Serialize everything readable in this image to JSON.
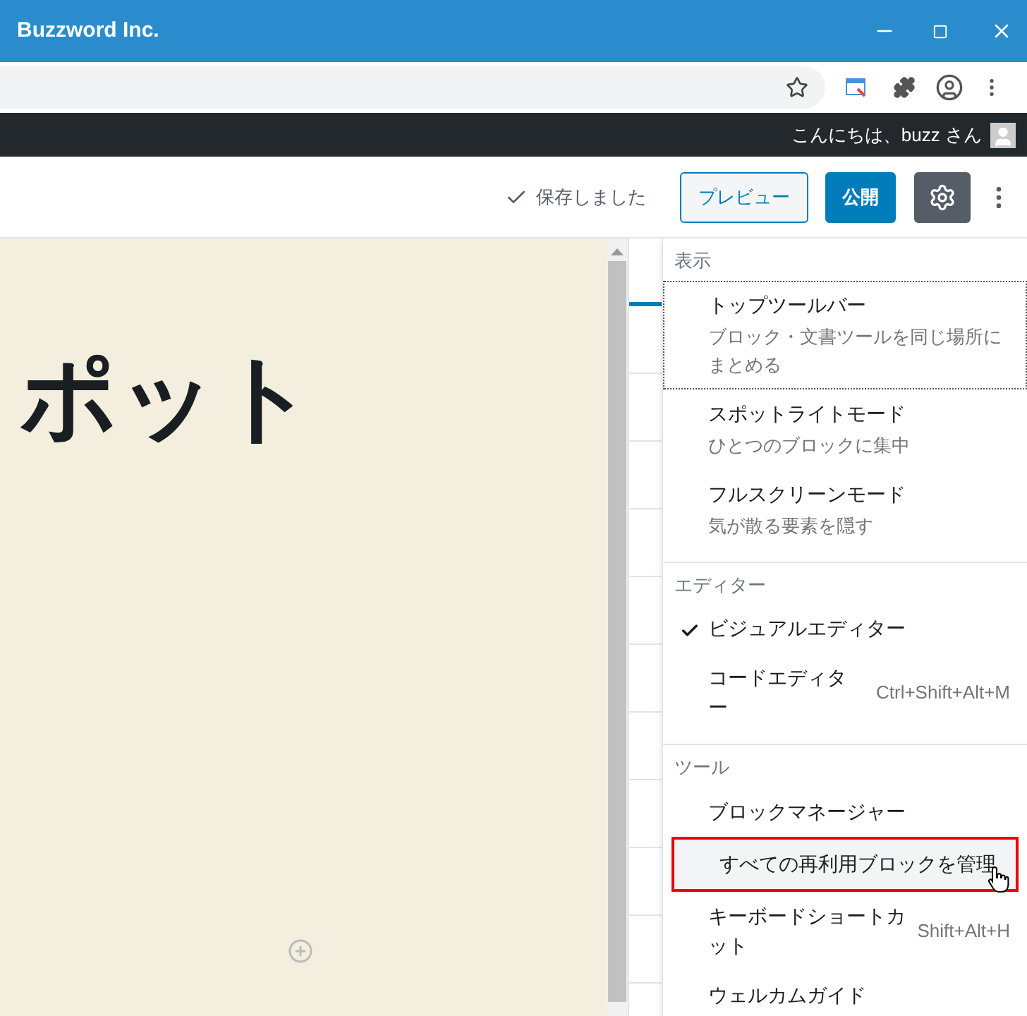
{
  "window": {
    "title": "Buzzword Inc."
  },
  "admin_bar": {
    "greeting": "こんにちは、buzz さん"
  },
  "editor_header": {
    "status": "保存しました",
    "buttons": [
      {
        "label": "プレビュー",
        "kind": "secondary"
      },
      {
        "label": "公開",
        "kind": "primary"
      }
    ],
    "settings_selected": true
  },
  "canvas": {
    "title": "ポット"
  },
  "menu": {
    "sections": [
      {
        "title": "表示",
        "items": [
          {
            "label": "トップツールバー",
            "description": "ブロック・文書ツールを同じ場所にまとめる",
            "checked": false,
            "selected": true,
            "highlighted": false
          },
          {
            "label": "スポットライトモード",
            "description": "ひとつのブロックに集中",
            "checked": false,
            "selected": false,
            "highlighted": false
          },
          {
            "label": "フルスクリーンモード",
            "description": "気が散る要素を隠す",
            "checked": false,
            "selected": false,
            "highlighted": false
          }
        ]
      },
      {
        "title": "エディター",
        "items": [
          {
            "label": "ビジュアルエディター",
            "checked": true,
            "selected": false,
            "highlighted": false
          },
          {
            "label": "コードエディター",
            "shortcut": "Ctrl+Shift+Alt+M",
            "checked": false,
            "selected": false,
            "highlighted": false
          }
        ]
      },
      {
        "title": "ツール",
        "items": [
          {
            "label": "ブロックマネージャー",
            "checked": false,
            "selected": false,
            "highlighted": false
          },
          {
            "label": "すべての再利用ブロックを管理",
            "checked": false,
            "selected": false,
            "highlighted": true
          },
          {
            "label": "キーボードショートカット",
            "shortcut": "Shift+Alt+H",
            "checked": false,
            "selected": false,
            "highlighted": false
          },
          {
            "label": "ウェルカムガイド",
            "checked": false,
            "selected": false,
            "highlighted": false
          }
        ]
      }
    ]
  }
}
